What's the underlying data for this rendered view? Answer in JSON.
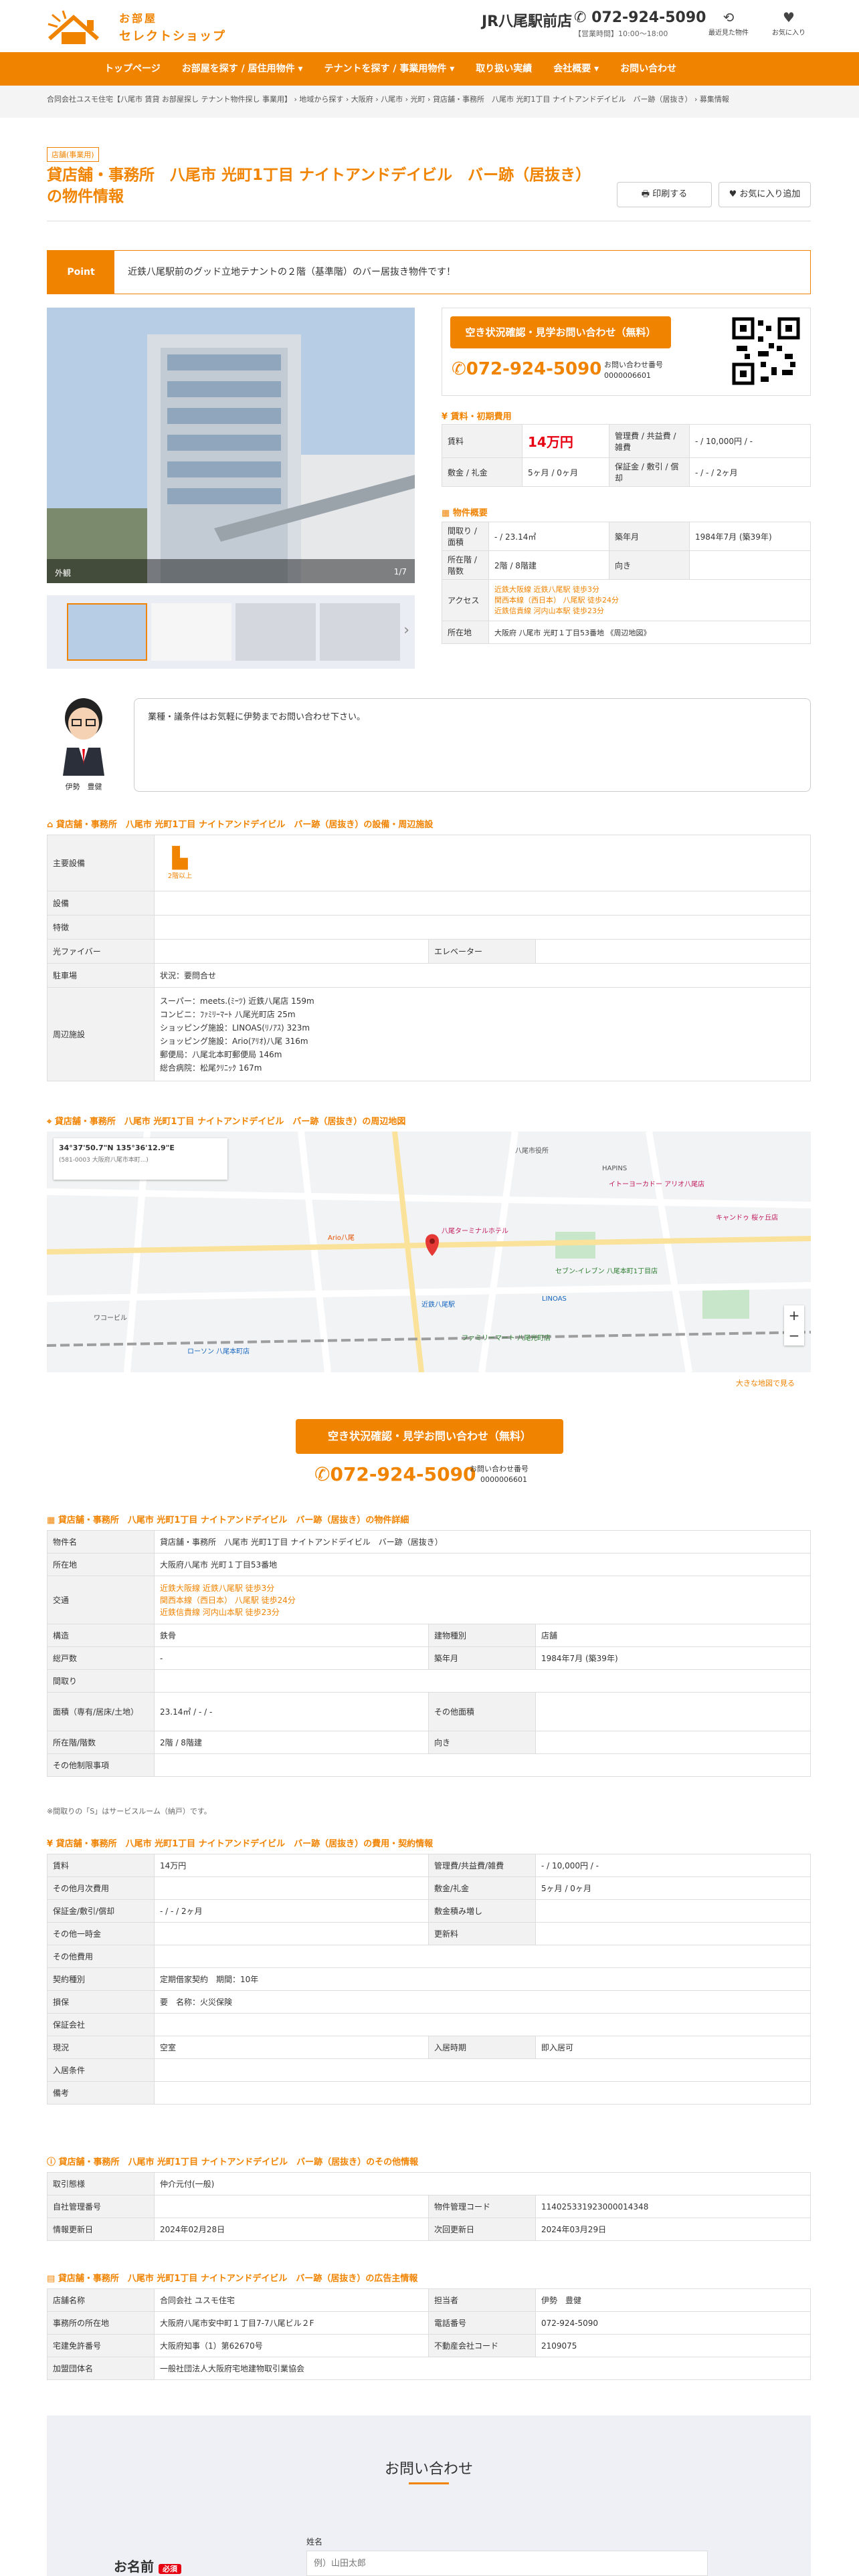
{
  "header": {
    "logo_line1": "お部屋",
    "logo_line2": "セレクトショップ",
    "store": "JR八尾駅前店",
    "tel": "072-924-5090",
    "hours": "【営業時間】10:00〜18:00",
    "icons": [
      {
        "label": "最近見た物件",
        "icon": "history-icon",
        "glyph": "⟲"
      },
      {
        "label": "お気に入り",
        "icon": "heart-icon",
        "glyph": "♥"
      }
    ]
  },
  "nav": [
    "トップページ",
    "お部屋を探す / 居住用物件 ▾",
    "テナントを探す / 事業用物件 ▾",
    "取り扱い実績",
    "会社概要 ▾",
    "お問い合わせ"
  ],
  "breadcrumb": "合同会社ユスモ住宅【八尾市 賃貸 お部屋探し テナント物件探し 事業用】 › 地域から探す › 大阪府 › 八尾市 › 光町 › 貸店舗・事務所　八尾市 光町1丁目 ナイトアンドデイビル　バー跡（居抜き） › 募集情報",
  "badge": "店舗(事業用)",
  "title": "貸店舗・事務所　八尾市 光町1丁目 ナイトアンドデイビル　バー跡（居抜き）の物件情報",
  "print_btn": "🖶 印刷する",
  "fav_btn": "♥ お気に入り追加",
  "point": {
    "label": "Point",
    "text": "近鉄八尾駅前のグッド立地テナントの２階（基準階）のバー居抜き物件です！"
  },
  "photo": {
    "caption": "外観",
    "counter": "1/7"
  },
  "cta": {
    "button": "空き状況確認・見学お問い合わせ（無料）",
    "tel": "072-924-5090",
    "id_label": "お問い合わせ番号",
    "id": "0000006601"
  },
  "fee": {
    "title": "賃料・初期費用",
    "rows": [
      [
        "賃料",
        "14万円",
        "管理費 / 共益費 / 雑費",
        "- / 10,000円 / -"
      ],
      [
        "敷金 / 礼金",
        "5ヶ月 / 0ヶ月",
        "保証金 / 敷引 / 償却",
        "- / - / 2ヶ月"
      ]
    ]
  },
  "outline": {
    "title": "物件概要",
    "madori": "間取り / 面積",
    "madori_v": "- / 23.14㎡",
    "chikunen": "築年月",
    "chikunen_v": "1984年7月 (築39年)",
    "floor": "所在階 / 階数",
    "floor_v": "2階 / 8階建",
    "muki": "向き",
    "muki_v": "",
    "access": "アクセス",
    "access_v": [
      "近鉄大阪線 近鉄八尾駅 徒歩3分",
      "関西本線（西日本） 八尾駅 徒歩24分",
      "近鉄信貴線 河内山本駅 徒歩23分"
    ],
    "addr": "所在地",
    "addr_v": "大阪府 八尾市 光町１丁目53番地 《周辺地図》"
  },
  "staff": {
    "name": "伊勢　豊健",
    "message": "業種・議条件はお気軽に伊勢までお問い合わせ下さい。"
  },
  "facility": {
    "title": "貸店舗・事務所　八尾市 光町1丁目 ナイトアンドデイビル　バー跡（居抜き）の設備・周辺施設",
    "rows": [
      {
        "k": "主要設備",
        "v": "2階以上"
      },
      {
        "k": "設備",
        "v": ""
      },
      {
        "k": "特徴",
        "v": ""
      },
      {
        "k": "光ファイバー",
        "v": "",
        "k2": "エレベーター",
        "v2": ""
      },
      {
        "k": "駐車場",
        "v": "状況：要問合せ"
      },
      {
        "k": "周辺施設",
        "lines": [
          "スーパー：meets.(ﾐｰﾂ) 近鉄八尾店 159m",
          "コンビニ：ﾌｧﾐﾘｰﾏｰﾄ 八尾光町店 25m",
          "ショッピング施設：LINOAS(ﾘﾉｱｽ) 323m",
          "ショッピング施設：Ario(ｱﾘｵ)八尾 316m",
          "郵便局：八尾北本町郵便局 146m",
          "総合病院：松尾ｸﾘﾆｯｸ 167m"
        ]
      }
    ]
  },
  "map": {
    "title": "貸店舗・事務所　八尾市 光町1丁目 ナイトアンドデイビル　バー跡（居抜き）の周辺地図",
    "coords": "34°37'50.7\"N 135°36'12.9\"E",
    "sub": "(581-0003 大阪府八尾市本町...)",
    "link": "大きな地図で見る",
    "labels": [
      "八尾市役所",
      "近鉄八尾駅",
      "八尾ターミナルホテル",
      "Ario八尾",
      "イトーヨーカドー アリオ八尾店",
      "LINOAS",
      "セブン-イレブン 八尾本町1丁目店",
      "ファミリーマート 八尾光町店",
      "キャンドゥ 桜ヶ丘店",
      "ローソン 八尾本町店",
      "ワコービル",
      "HAPINS"
    ]
  },
  "cta2": {
    "button": "空き状況確認・見学お問い合わせ（無料）",
    "tel": "072-924-5090",
    "id_label": "お問い合わせ番号",
    "id": "0000006601"
  },
  "detail": {
    "title": "貸店舗・事務所　八尾市 光町1丁目 ナイトアンドデイビル　バー跡（居抜き）の物件詳細",
    "rows": [
      [
        "物件名",
        "貸店舗・事務所　八尾市 光町1丁目 ナイトアンドデイビル　バー跡（居抜き）"
      ],
      [
        "所在地",
        "大阪府八尾市 光町１丁目53番地"
      ],
      [
        "交通",
        "近鉄大阪線 近鉄八尾駅 徒歩3分|関西本線（西日本） 八尾駅 徒歩24分|近鉄信貴線 河内山本駅 徒歩23分"
      ],
      [
        "構造",
        "鉄骨",
        "建物種別",
        "店舗"
      ],
      [
        "総戸数",
        "-",
        "築年月",
        "1984年7月 (築39年)"
      ],
      [
        "間取り",
        ""
      ],
      [
        "面積（専有/居床/土地）",
        "23.14㎡ / - / -",
        "その他面積",
        ""
      ],
      [
        "所在階/階数",
        "2階 / 8階建",
        "向き",
        ""
      ],
      [
        "その他制限事項",
        ""
      ]
    ],
    "note": "※間取りの「S」はサービスルーム（納戸）です。"
  },
  "cost": {
    "title": "貸店舗・事務所　八尾市 光町1丁目 ナイトアンドデイビル　バー跡（居抜き）の費用・契約情報",
    "rows": [
      [
        "賃料",
        "14万円",
        "管理費/共益費/雑費",
        "- / 10,000円 / -"
      ],
      [
        "その他月次費用",
        "",
        "敷金/礼金",
        "5ヶ月 / 0ヶ月"
      ],
      [
        "保証金/敷引/償却",
        "- / - / 2ヶ月",
        "敷金積み増し",
        ""
      ],
      [
        "その他一時金",
        "",
        "更新料",
        ""
      ],
      [
        "その他費用",
        ""
      ],
      [
        "契約種別",
        "定期借家契約　期間：10年"
      ],
      [
        "損保",
        "要　名称：火災保険"
      ],
      [
        "保証会社",
        ""
      ],
      [
        "現況",
        "空室",
        "入居時期",
        "即入居可"
      ],
      [
        "入居条件",
        ""
      ],
      [
        "備考",
        ""
      ]
    ]
  },
  "other": {
    "title": "貸店舗・事務所　八尾市 光町1丁目 ナイトアンドデイビル　バー跡（居抜き）のその他情報",
    "rows": [
      [
        "取引態様",
        "仲介元付(一般)"
      ],
      [
        "自社管理番号",
        "",
        "物件管理コード",
        "114025331923000014348"
      ],
      [
        "情報更新日",
        "2024年02月28日",
        "次回更新日",
        "2024年03月29日"
      ]
    ]
  },
  "ad": {
    "title": "貸店舗・事務所　八尾市 光町1丁目 ナイトアンドデイビル　バー跡（居抜き）の広告主情報",
    "rows": [
      [
        "店舗名称",
        "合同会社 ユスモ住宅",
        "担当者",
        "伊勢　豊健"
      ],
      [
        "事務所の所在地",
        "大阪府八尾市安中町１丁目7-7八尾ビル２F",
        "電話番号",
        "072-924-5090"
      ],
      [
        "宅建免許番号",
        "大阪府知事（1）第62670号",
        "不動産会社コード",
        "2109075"
      ],
      [
        "加盟団体名",
        "一般社団法人大阪府宅地建物取引業協会"
      ]
    ]
  },
  "contact": {
    "title": "お問い合わせ",
    "name_label": "お名前",
    "required": "必須",
    "field_label": "姓名",
    "placeholder": "例）山田太郎"
  },
  "colors": {
    "accent": "#f08300",
    "border": "#dddddd"
  }
}
